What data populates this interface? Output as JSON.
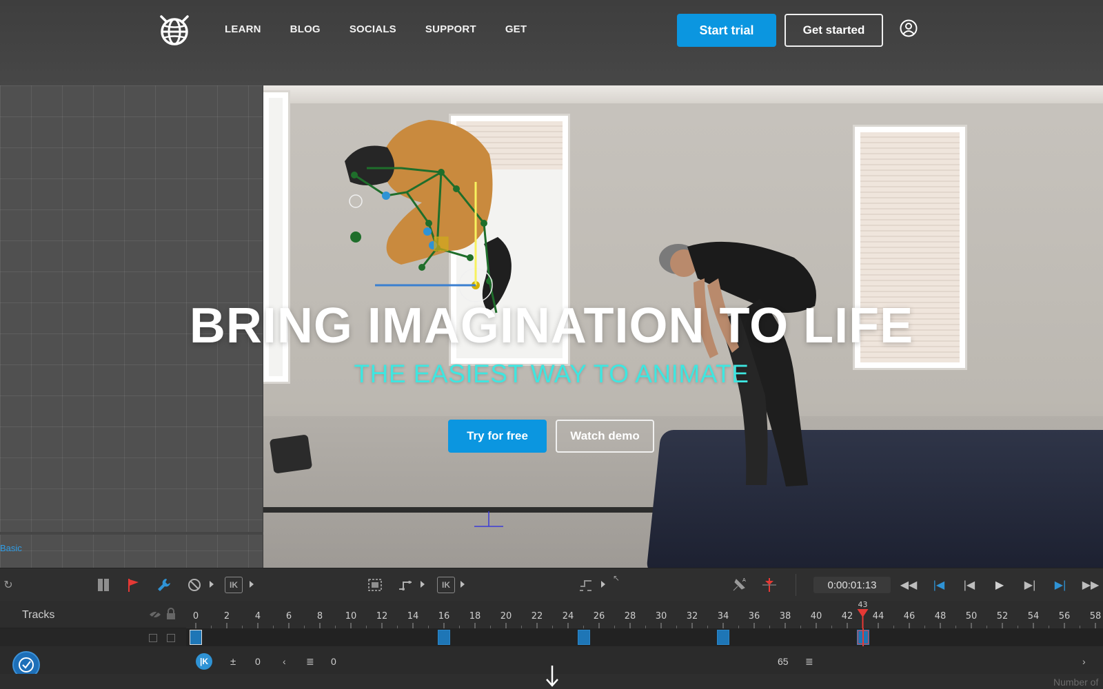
{
  "nav": {
    "items": [
      "LEARN",
      "BLOG",
      "SOCIALS",
      "SUPPORT",
      "GET"
    ],
    "start_trial": "Start trial",
    "get_started": "Get started"
  },
  "hero": {
    "title": "BRING IMAGINATION TO LIFE",
    "subtitle": "THE EASIEST WAY TO ANIMATE",
    "try_free": "Try for free",
    "watch_demo": "Watch demo"
  },
  "panel": {
    "label": "Basic"
  },
  "toolbar": {
    "ik_label": "IK",
    "timecode": "0:00:01:13"
  },
  "timeline": {
    "tracks_label": "Tracks",
    "ruler_ticks": [
      "0",
      "2",
      "4",
      "6",
      "8",
      "10",
      "12",
      "14",
      "16",
      "18",
      "20",
      "22",
      "24",
      "26",
      "28",
      "30",
      "32",
      "34",
      "36",
      "38",
      "40",
      "42",
      "44",
      "46",
      "48",
      "50",
      "52",
      "54",
      "56",
      "58"
    ],
    "current_frame": "43",
    "keyframes": [
      0,
      16,
      25,
      34,
      43
    ],
    "field_start": "0",
    "field_mid": "0",
    "field_end": "65",
    "status_text": "Number of"
  },
  "colors": {
    "accent": "#0b96e0",
    "hero_subtitle": "#3ee6e0",
    "playhead": "#e53935"
  },
  "icons": {
    "logo": "cat-globe-logo",
    "account": "user-circle-icon"
  }
}
